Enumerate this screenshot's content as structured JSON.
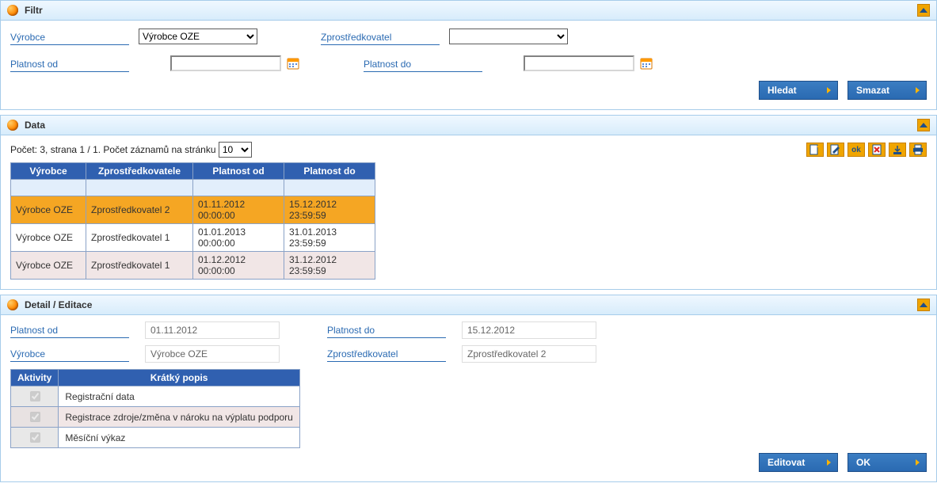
{
  "sections": {
    "filter": {
      "title": "Filtr"
    },
    "data": {
      "title": "Data"
    },
    "detail": {
      "title": "Detail / Editace"
    }
  },
  "filter": {
    "vyrobce_label": "Výrobce",
    "vyrobce_value": "Výrobce OZE",
    "zprostredkovatel_label": "Zprostředkovatel",
    "zprostredkovatel_value": "",
    "platnost_od_label": "Platnost od",
    "platnost_od_value": "",
    "platnost_do_label": "Platnost do",
    "platnost_do_value": "",
    "hledat": "Hledat",
    "smazat": "Smazat"
  },
  "data": {
    "pocet_prefix": "Počet: ",
    "count": "3",
    "strana_text": ", strana 1 / 1. Počet záznamů na stránku",
    "page_size": "10",
    "columns": {
      "vyrobce": "Výrobce",
      "zprostredkovatele": "Zprostředkovatele",
      "platnost_od": "Platnost od",
      "platnost_do": "Platnost do"
    },
    "rows": [
      {
        "vyrobce": "Výrobce OZE",
        "zprostredkovatel": "Zprostředkovatel 2",
        "platnost_od": "01.11.2012 00:00:00",
        "platnost_do": "15.12.2012 23:59:59",
        "selected": true
      },
      {
        "vyrobce": "Výrobce OZE",
        "zprostredkovatel": "Zprostředkovatel 1",
        "platnost_od": "01.01.2013 00:00:00",
        "platnost_do": "31.01.2013 23:59:59"
      },
      {
        "vyrobce": "Výrobce OZE",
        "zprostredkovatel": "Zprostředkovatel 1",
        "platnost_od": "01.12.2012 00:00:00",
        "platnost_do": "31.12.2012 23:59:59"
      }
    ],
    "toolbar": {
      "ok_label": "ok"
    }
  },
  "detail": {
    "platnost_od_label": "Platnost od",
    "platnost_od_value": "01.11.2012",
    "platnost_do_label": "Platnost do",
    "platnost_do_value": "15.12.2012",
    "vyrobce_label": "Výrobce",
    "vyrobce_value": "Výrobce OZE",
    "zprostredkovatel_label": "Zprostředkovatel",
    "zprostredkovatel_value": "Zprostředkovatel 2",
    "activities_header": "Aktivity",
    "kratky_popis_header": "Krátký popis",
    "activities": [
      {
        "label": "Registrační data",
        "checked": true
      },
      {
        "label": "Registrace zdroje/změna v nároku na výplatu podporu",
        "checked": true
      },
      {
        "label": "Měsíční výkaz",
        "checked": true
      }
    ],
    "editovat": "Editovat",
    "ok": "OK"
  }
}
